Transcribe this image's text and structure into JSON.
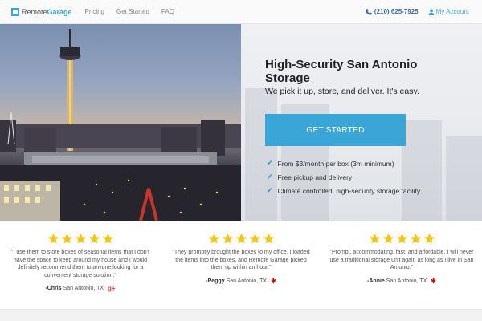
{
  "nav": {
    "brand_part1": "Remote",
    "brand_part2": "Garage",
    "links": [
      "Pricing",
      "Get Started",
      "FAQ"
    ],
    "phone": "(210) 625-7925",
    "account": "My Account"
  },
  "hero": {
    "title": "High-Security San Antonio Storage",
    "subtitle": "We pick it up, store, and deliver. It's easy.",
    "cta_label": "GET STARTED",
    "features": [
      "From $3/month per box (3m minimum)",
      "Free pickup and delivery",
      "Climate controlled, high-security storage facility"
    ]
  },
  "testimonials": [
    {
      "rating": 5,
      "quote": "\"I use them to store boxes of seasonal items that I don't have the space to keep around my house and I would definitely recommend them to anyone looking for a convenient storage solution.\"",
      "name": "-Chris",
      "location": "San Antonio, TX",
      "source_icon": "google-plus-icon",
      "source_text": "g+"
    },
    {
      "rating": 5,
      "quote": "\"They promptly brought the boxes to my office, I loaded the items into the boxes, and Remote Garage picked them up within an hour.\"",
      "name": "-Peggy",
      "location": "San Antonio, TX",
      "source_icon": "yelp-icon",
      "source_text": "✱"
    },
    {
      "rating": 5,
      "quote": "\"Prompt, accommodating, fast, and affordable. I will never use a traditional storage unit again as long as I live in San Antonio.\"",
      "name": "-Annie",
      "location": "San Antonio, TX",
      "source_icon": "yelp-icon",
      "source_text": "✱"
    }
  ],
  "colors": {
    "accent": "#3aa6d8",
    "star": "#f5c518"
  }
}
